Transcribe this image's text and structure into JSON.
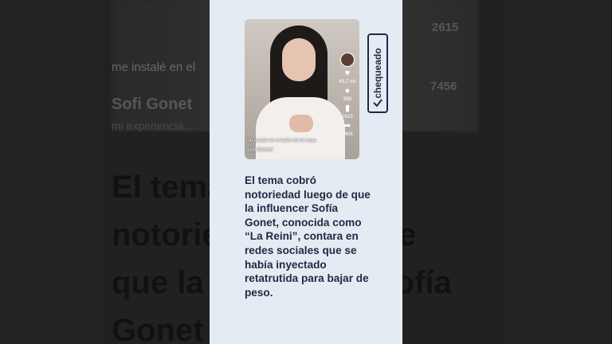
{
  "background": {
    "overlay_caption": "me instalé en el",
    "username": "Sofi Gonet",
    "subcaption": "mi experiencia...",
    "count_top": "2615",
    "count_share": "7456",
    "big_text": "El tema\nnotoriedad luego de\nque la influencer Sofía\nGonet"
  },
  "video": {
    "likes": "45,7 mil",
    "comments": "889",
    "saves": "2615",
    "shares": "7456",
    "caption": "me instalé en el baño de mi casa",
    "username": "Sofi Gonet"
  },
  "logo": {
    "text": "chequeado"
  },
  "article": {
    "text": "El tema cobró notoriedad luego de que la influencer Sofía Gonet, conocida como “La Reini”, contara en redes sociales que se había inyectado retatrutida para bajar de peso."
  },
  "colors": {
    "card_bg": "#e4ebf3",
    "text": "#1f2a44",
    "accent": "#fe2c55"
  }
}
